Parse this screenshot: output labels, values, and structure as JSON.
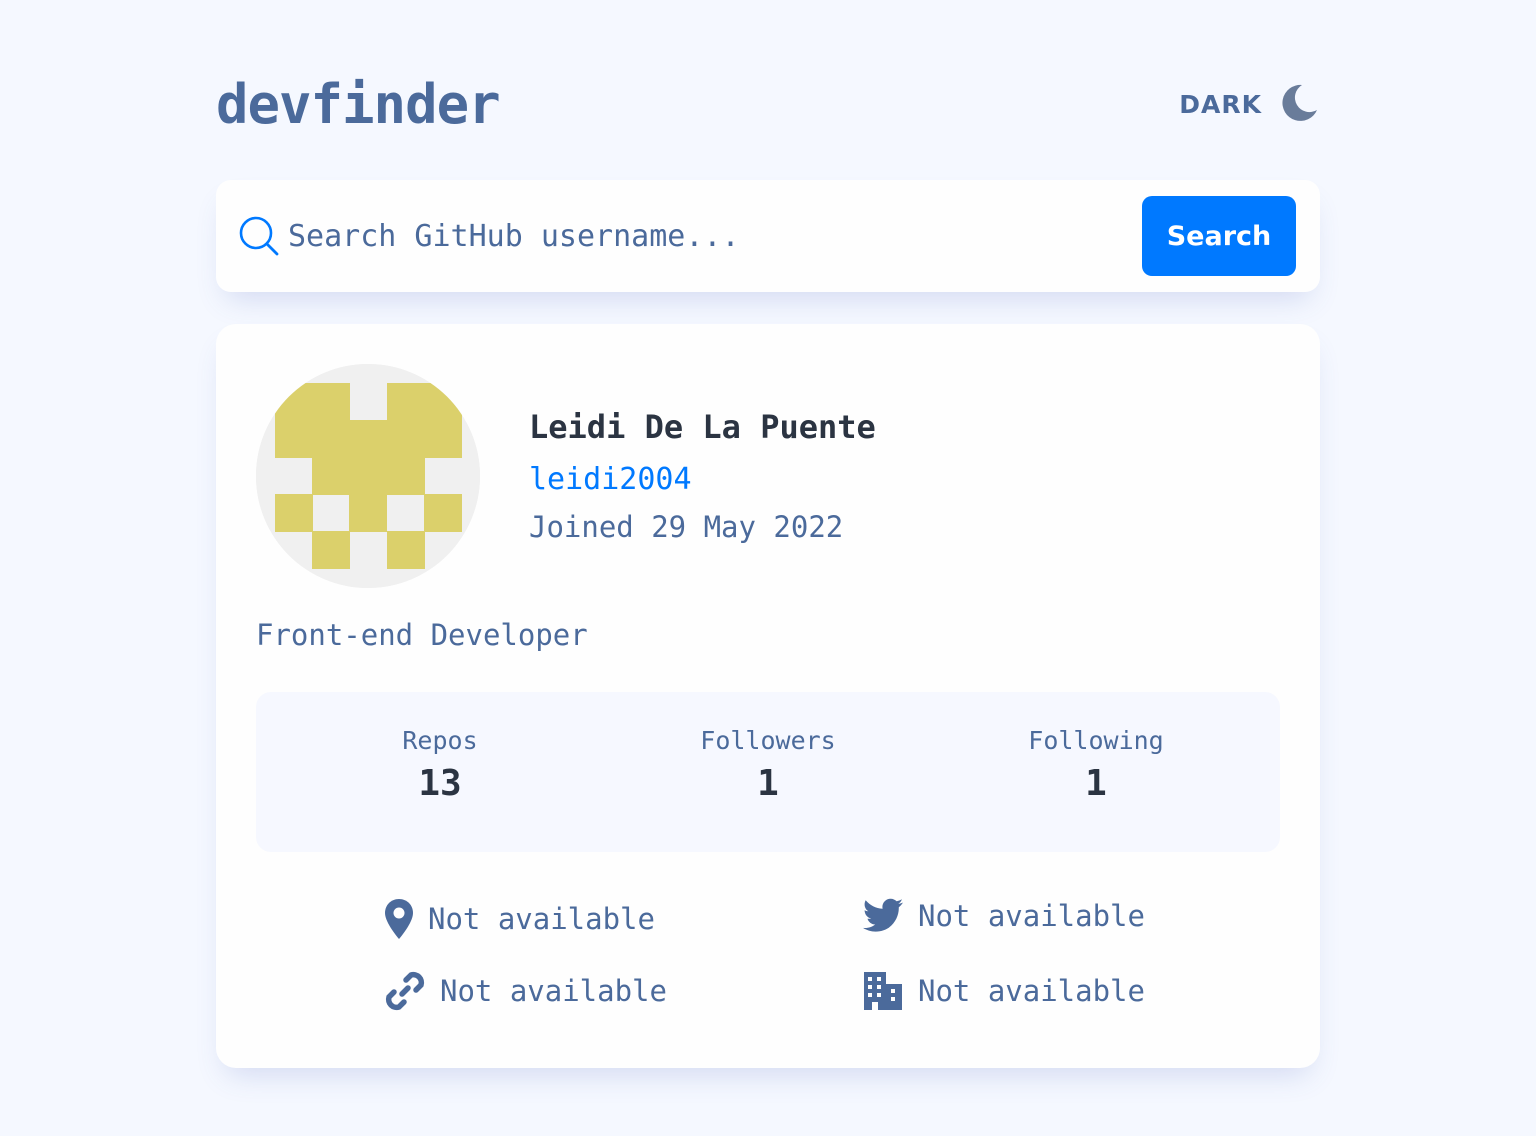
{
  "app": {
    "title": "devfinder",
    "theme_toggle_label": "DARK"
  },
  "search": {
    "placeholder": "Search GitHub username...",
    "value": "",
    "button_label": "Search"
  },
  "profile": {
    "name": "Leidi De La Puente",
    "login": "leidi2004",
    "joined": "Joined 29 May 2022",
    "bio": "Front-end Developer",
    "avatar_color": "#dbd06b",
    "avatar_bg": "#f0f0f0"
  },
  "stats": [
    {
      "label": "Repos",
      "value": "13"
    },
    {
      "label": "Followers",
      "value": "1"
    },
    {
      "label": "Following",
      "value": "1"
    }
  ],
  "links": {
    "location": {
      "icon": "location-pin-icon",
      "text": "Not available"
    },
    "twitter": {
      "icon": "twitter-icon",
      "text": "Not available"
    },
    "blog": {
      "icon": "link-icon",
      "text": "Not available"
    },
    "company": {
      "icon": "building-icon",
      "text": "Not available"
    }
  },
  "colors": {
    "background": "#f5f8ff",
    "accent": "#0079ff",
    "text": "#4b6a9b",
    "heading": "#2b3442",
    "card": "#fefefe",
    "stats_bg": "#f6f8ff"
  }
}
